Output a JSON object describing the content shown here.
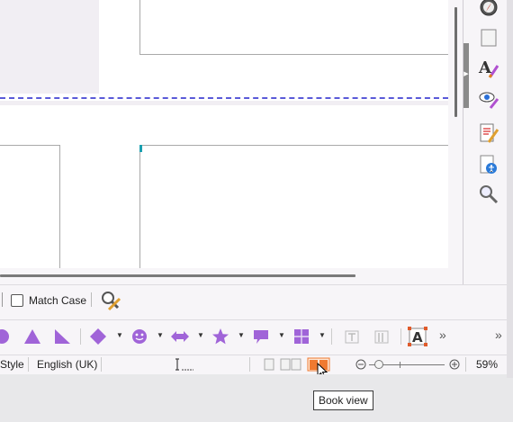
{
  "find_bar": {
    "match_case_label": "Match Case"
  },
  "status_bar": {
    "page_style": "Style",
    "language": "English (UK)",
    "zoom_percent": "59%",
    "zoom_level": 0.59
  },
  "tooltip": {
    "text": "Book view"
  },
  "toolbar": {
    "more_label": "»",
    "overflow_label": "»"
  },
  "colors": {
    "accent_shape": "#a064d8",
    "book_view_active": "#f07a30",
    "dashed_guide": "#5a5ad8"
  },
  "icons": {
    "sidebar": [
      "navigator-icon",
      "page-icon",
      "styles-icon",
      "gallery-icon",
      "manage-changes-icon",
      "accessibility-check-icon",
      "find-icon"
    ],
    "drawing": [
      "circle-shape-icon",
      "triangle-shape-icon",
      "right-triangle-shape-icon",
      "diamond-shape-icon",
      "smiley-shape-icon",
      "double-arrow-shape-icon",
      "star-shape-icon",
      "callout-shape-icon",
      "flowchart-shape-icon",
      "text-frame-icon",
      "vertical-text-frame-icon",
      "fontwork-icon"
    ]
  }
}
